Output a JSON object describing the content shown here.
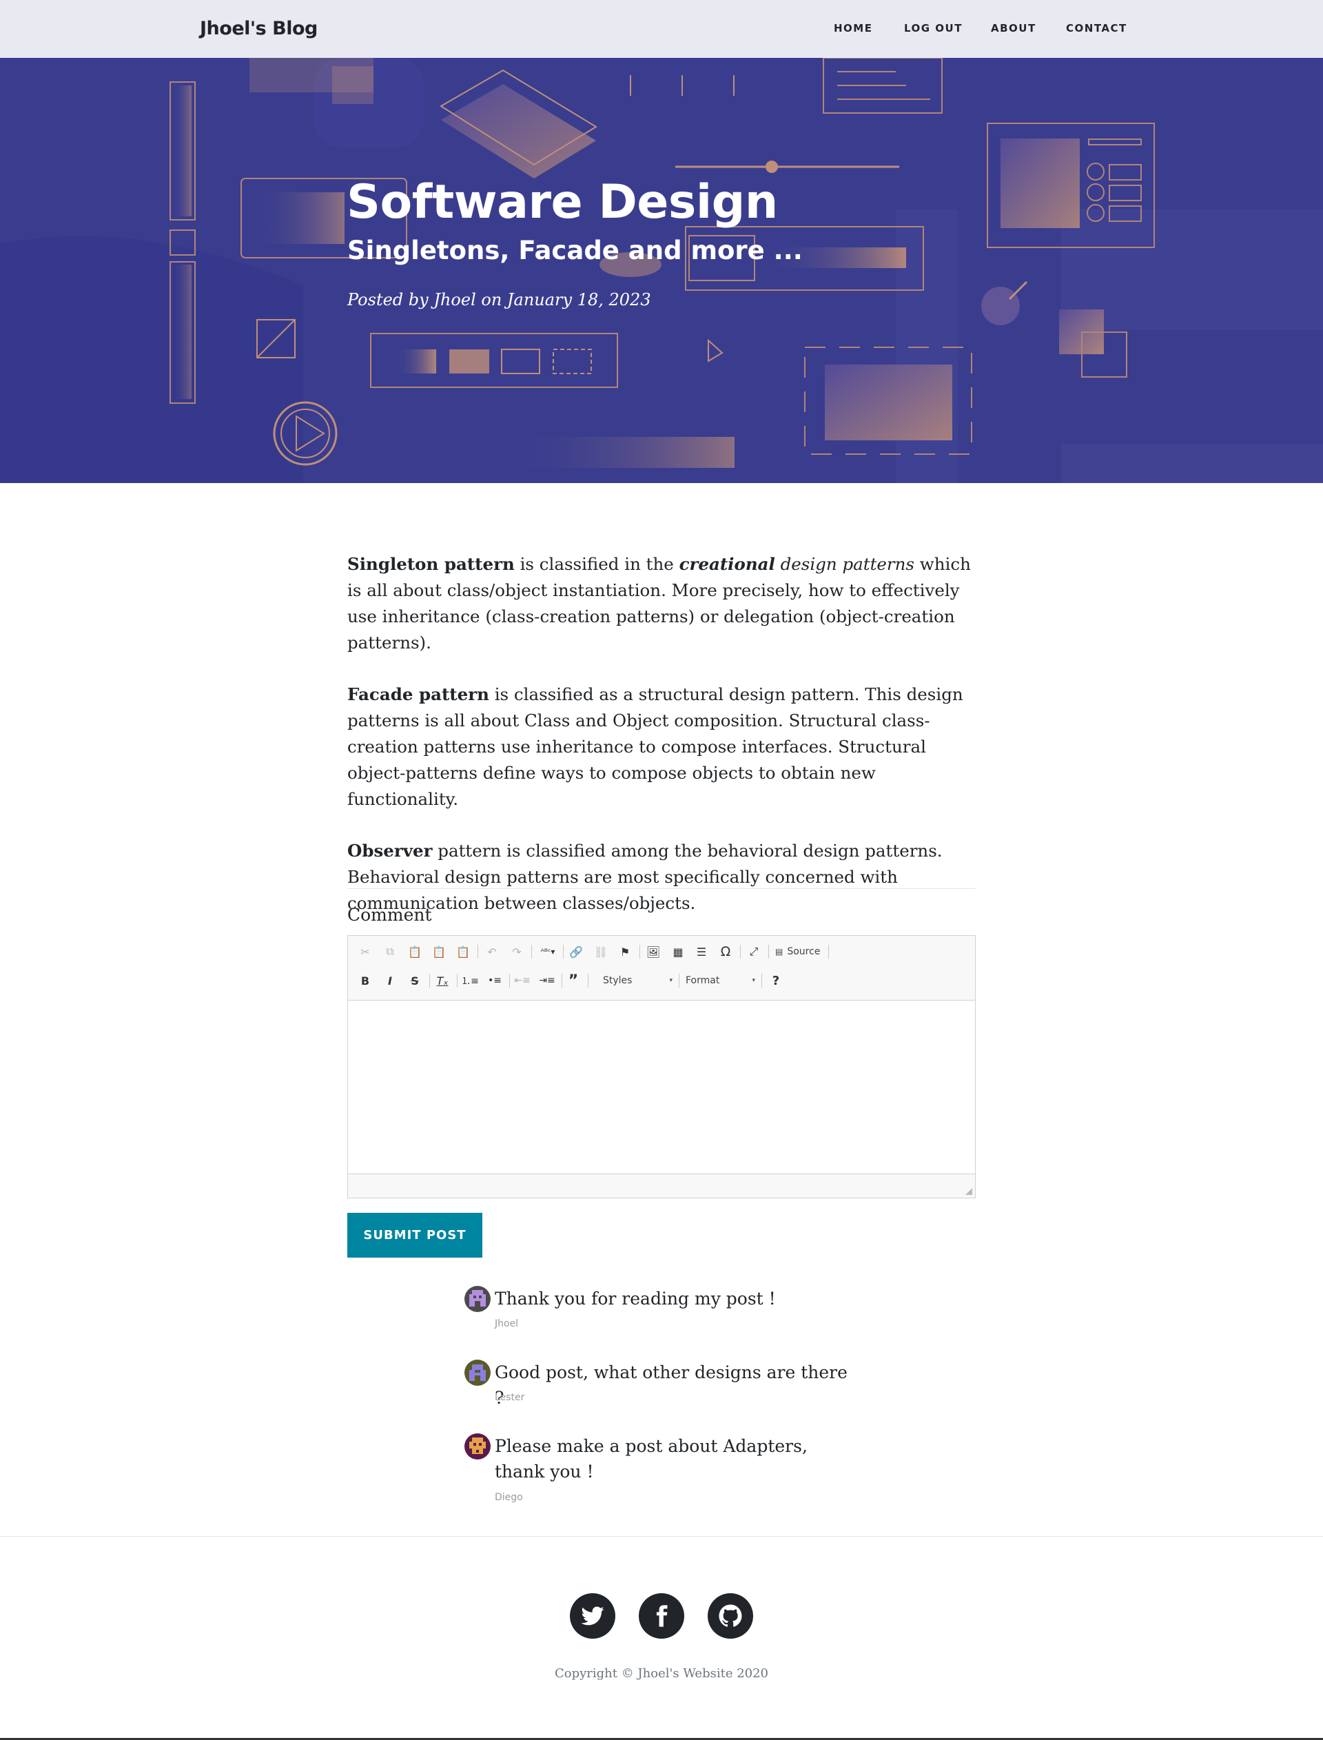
{
  "nav": {
    "brand": "Jhoel's Blog",
    "links": [
      "HOME",
      "LOG OUT",
      "ABOUT",
      "CONTACT"
    ]
  },
  "hero": {
    "title": "Software Design",
    "subtitle": "Singletons, Facade and more ...",
    "meta": "Posted by Jhoel on January 18, 2023",
    "colors": {
      "background": "#3a3d8e",
      "accent": "#c08f7a"
    }
  },
  "article": {
    "p1": {
      "b1": "Singleton pattern",
      "t1": " is classified in the ",
      "bi": "creational",
      "i1": " design patterns",
      "t2": " which is all about class/object instantiation. More precisely, how to effectively use inheritance (class-creation patterns) or delegation (object-creation patterns)."
    },
    "p2": {
      "b1": "Facade pattern",
      "t1": " is classified as a structural design pattern. This design patterns is all about Class and Object composition. Structural class-creation patterns use inheritance to compose interfaces. Structural object-patterns define ways to compose objects to obtain new functionality."
    },
    "p3": {
      "b1": "Observer",
      "t1": " pattern is classified among the behavioral design patterns. Behavioral design patterns are most specifically concerned with communication between classes/objects."
    }
  },
  "form": {
    "label": "Comment",
    "toolbar": {
      "source": "Source",
      "styles": "Styles",
      "format": "Format",
      "icons": [
        "cut-icon",
        "copy-icon",
        "paste-icon",
        "paste-text-icon",
        "paste-word-icon",
        "undo-icon",
        "redo-icon",
        "spellcheck-icon",
        "link-icon",
        "unlink-icon",
        "anchor-icon",
        "image-icon",
        "table-icon",
        "horizontal-rule-icon",
        "special-char-icon",
        "maximize-icon",
        "source-icon",
        "bold-icon",
        "italic-icon",
        "strike-icon",
        "remove-format-icon",
        "numbered-list-icon",
        "bulleted-list-icon",
        "outdent-icon",
        "indent-icon",
        "blockquote-icon",
        "help-icon"
      ]
    },
    "submit": "SUBMIT POST",
    "submit_color": "#0085a1"
  },
  "comments": [
    {
      "text": "Thank you for reading my post !",
      "author": "Jhoel"
    },
    {
      "text": "Good post, what other designs are there ?",
      "author": "Lester"
    },
    {
      "text": "Please make a post about Adapters, thank you !",
      "author": "Diego"
    }
  ],
  "footer": {
    "social": [
      "twitter-icon",
      "facebook-icon",
      "github-icon"
    ],
    "copyright": "Copyright © Jhoel's Website 2020"
  }
}
